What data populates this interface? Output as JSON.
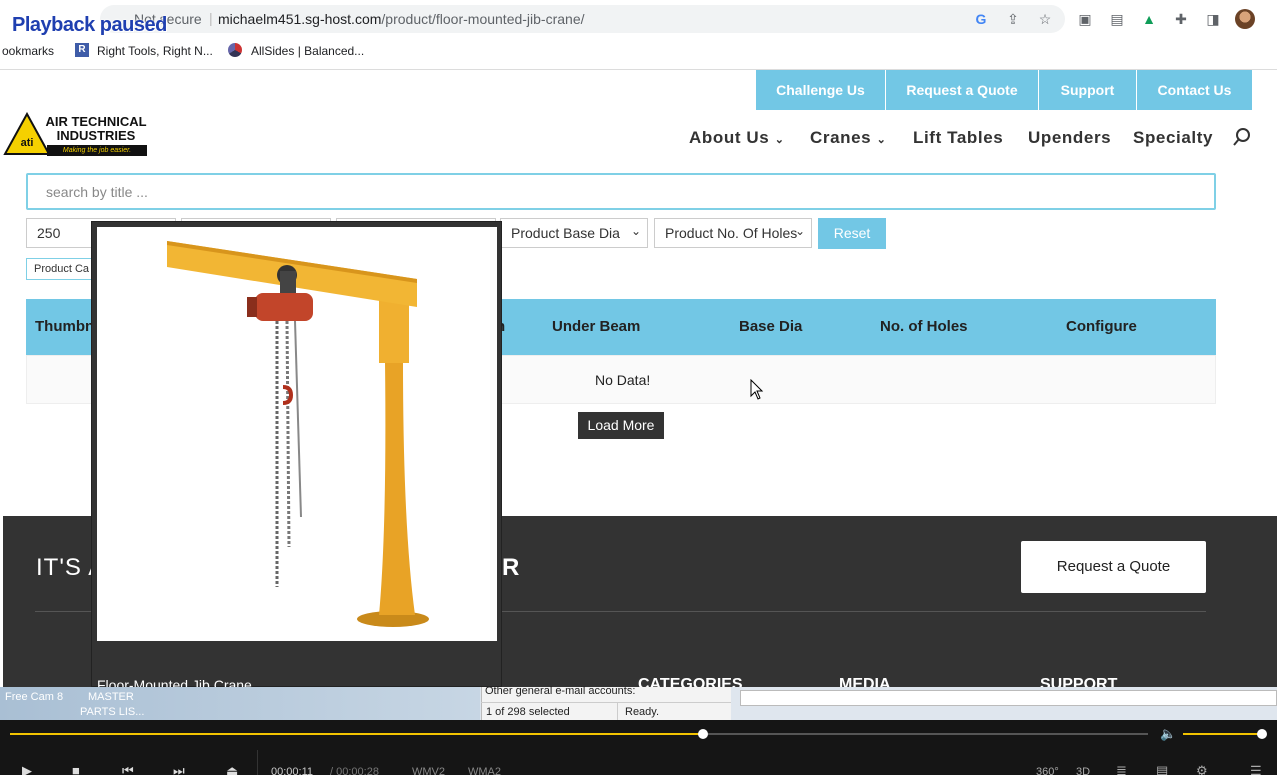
{
  "overlay": {
    "paused": "Playback paused"
  },
  "browser": {
    "not_secure": "Not secure",
    "url_host": "michaelm451.sg-host.com",
    "url_path": "/product/floor-mounted-jib-crane/",
    "bookmarks": [
      "ookmarks",
      "Right Tools, Right N...",
      "AllSides | Balanced..."
    ]
  },
  "site": {
    "top_buttons": [
      "Challenge Us",
      "Request a Quote",
      "Support",
      "Contact Us"
    ],
    "logo": {
      "line1": "AIR TECHNICAL",
      "line2": "INDUSTRIES",
      "tagline": "Making the job easier."
    },
    "nav": [
      "About Us",
      "Cranes",
      "Lift Tables",
      "Upenders",
      "Specialty"
    ],
    "search_placeholder": "search by title ...",
    "filters": {
      "capacity": "250",
      "base_dia": "Product Base Dia",
      "holes": "Product No. Of Holes",
      "reset": "Reset",
      "category": "Product Ca"
    },
    "table": {
      "headers": [
        "Thumbn",
        "n",
        "Under Beam",
        "Base Dia",
        "No. of Holes",
        "Configure"
      ],
      "empty": "No Data!"
    },
    "load_more": "Load More",
    "footer": {
      "cta_left": "IT'S A",
      "cta_right": "R",
      "request_quote": "Request a Quote",
      "columns": [
        "CATEGORIES",
        "MEDIA",
        "SUPPORT"
      ]
    }
  },
  "popup": {
    "caption": "Floor-Mounted Jib Crane"
  },
  "taskbar": {
    "item1": "Free Cam 8",
    "item2_line1": "MASTER",
    "item2_line2": "PARTS LIS...",
    "mail_line": "Other general e-mail accounts:",
    "selected": "1 of 298 selected",
    "status": "Ready."
  },
  "player": {
    "time_current": "00:00:11",
    "time_total": "/ 00:00:28",
    "tags": [
      "WMV2",
      "WMA2"
    ],
    "right_labels": [
      "360°",
      "3D"
    ],
    "progress": 0.61
  }
}
